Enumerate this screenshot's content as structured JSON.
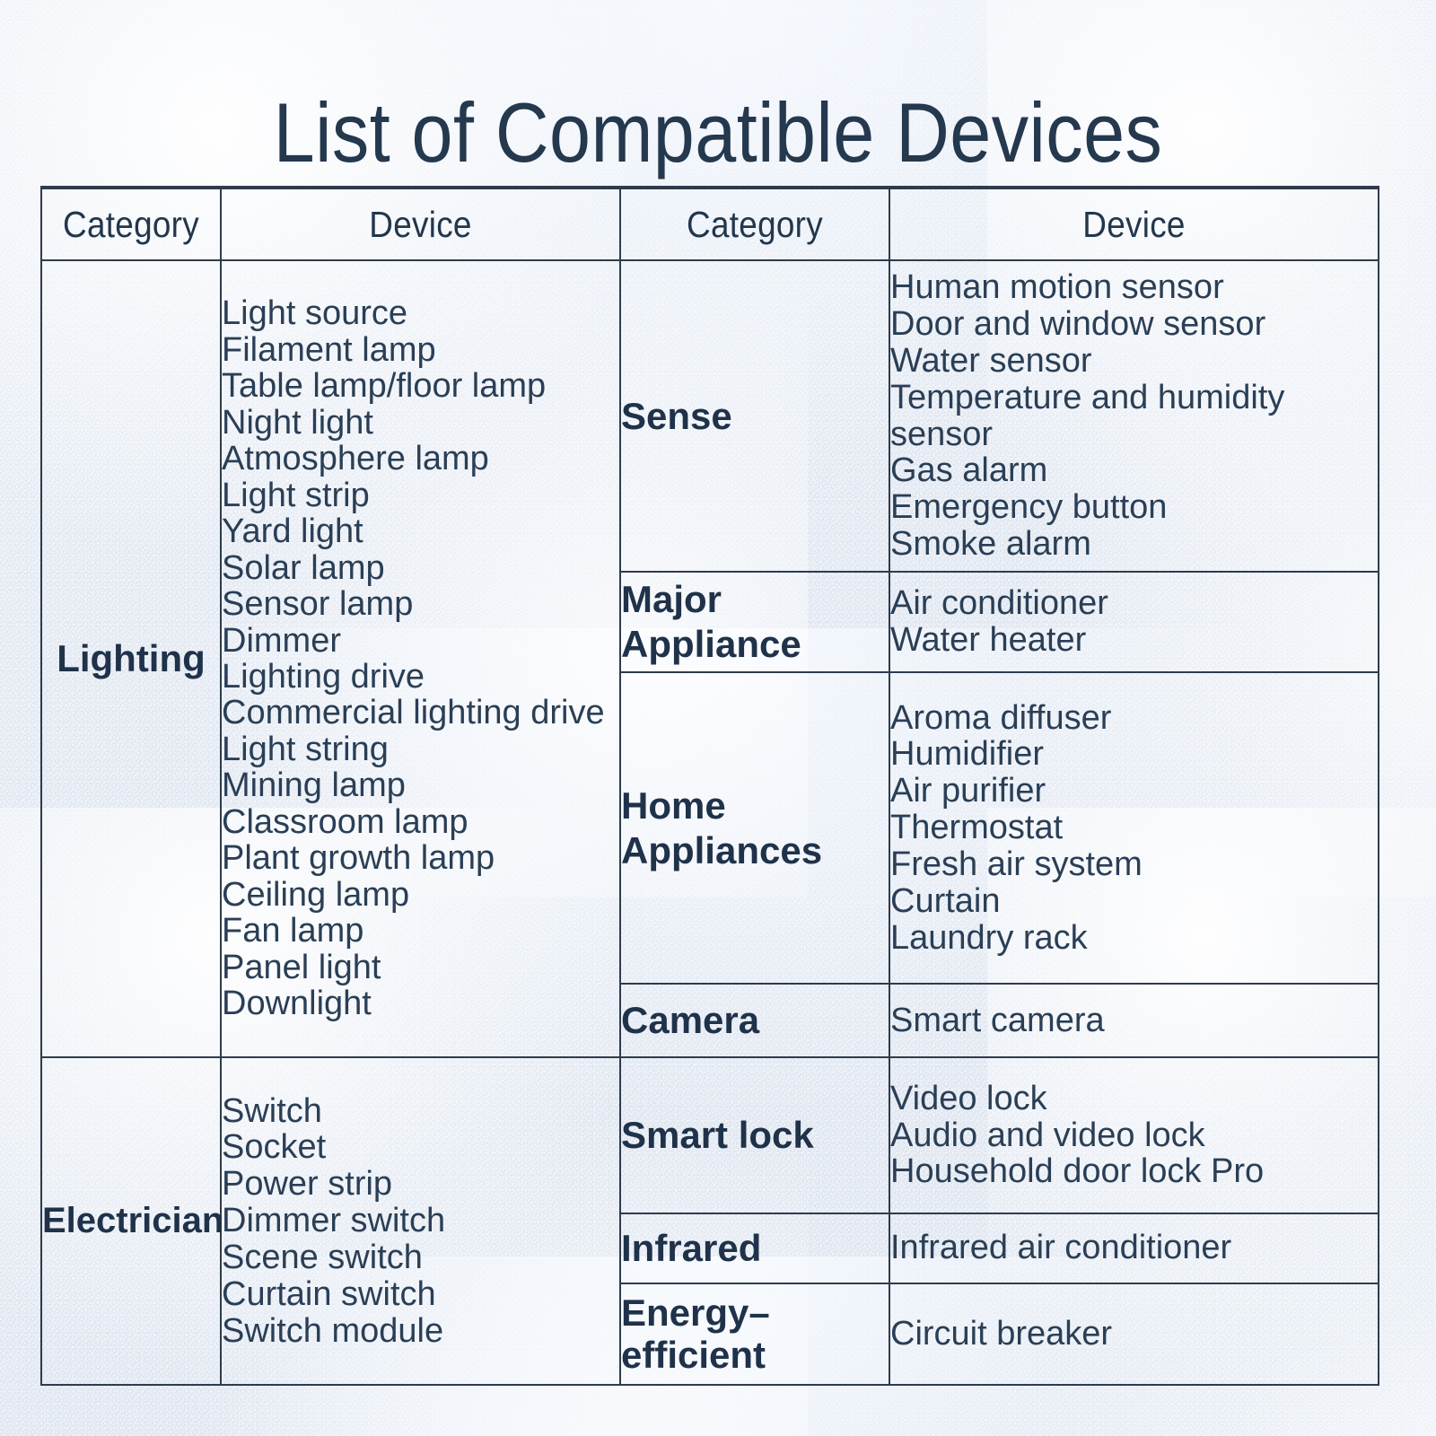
{
  "page": {
    "title": "List of Compatible Devices",
    "background_color": "#e4e9f2",
    "text_color": "#23374d",
    "border_color": "#2e3c4c"
  },
  "table": {
    "headers": {
      "left_category": "Category",
      "left_device": "Device",
      "right_category": "Category",
      "right_device": "Device"
    },
    "left_column": [
      {
        "category": "Lighting",
        "devices": [
          "Light source",
          "Filament lamp",
          "Table lamp/floor lamp",
          "Night light",
          "Atmosphere lamp",
          "Light strip",
          "Yard light",
          "Solar lamp",
          "Sensor lamp",
          "Dimmer",
          "Lighting drive",
          "Commercial lighting drive",
          "Light string",
          "Mining lamp",
          "Classroom lamp",
          "Plant growth lamp",
          "Ceiling lamp",
          "Fan lamp",
          "Panel light",
          "Downlight"
        ]
      },
      {
        "category": "Electrician",
        "devices": [
          "Switch",
          "Socket",
          "Power strip",
          "Dimmer switch",
          "Scene switch",
          "Curtain switch",
          "Switch module"
        ]
      }
    ],
    "right_column": [
      {
        "category": "Sense",
        "devices": [
          "Human motion sensor",
          "Door and window sensor",
          "Water sensor",
          "Temperature and humidity sensor",
          "Gas alarm",
          "Emergency button",
          "Smoke alarm"
        ]
      },
      {
        "category": "Major Appliance",
        "devices": [
          "Air conditioner",
          "Water heater"
        ]
      },
      {
        "category": "Home Appliances",
        "devices": [
          "Aroma diffuser",
          "Humidifier",
          "Air purifier",
          "Thermostat",
          "Fresh air system",
          "Curtain",
          "Laundry rack"
        ]
      },
      {
        "category": "Camera",
        "devices": [
          "Smart camera"
        ]
      },
      {
        "category": "Smart lock",
        "devices": [
          "Video lock",
          "Audio and video lock",
          "Household door lock Pro"
        ]
      },
      {
        "category": "Infrared",
        "devices": [
          "Infrared air conditioner"
        ]
      },
      {
        "category": "Energy–efficient",
        "devices": [
          "Circuit breaker"
        ]
      }
    ]
  }
}
